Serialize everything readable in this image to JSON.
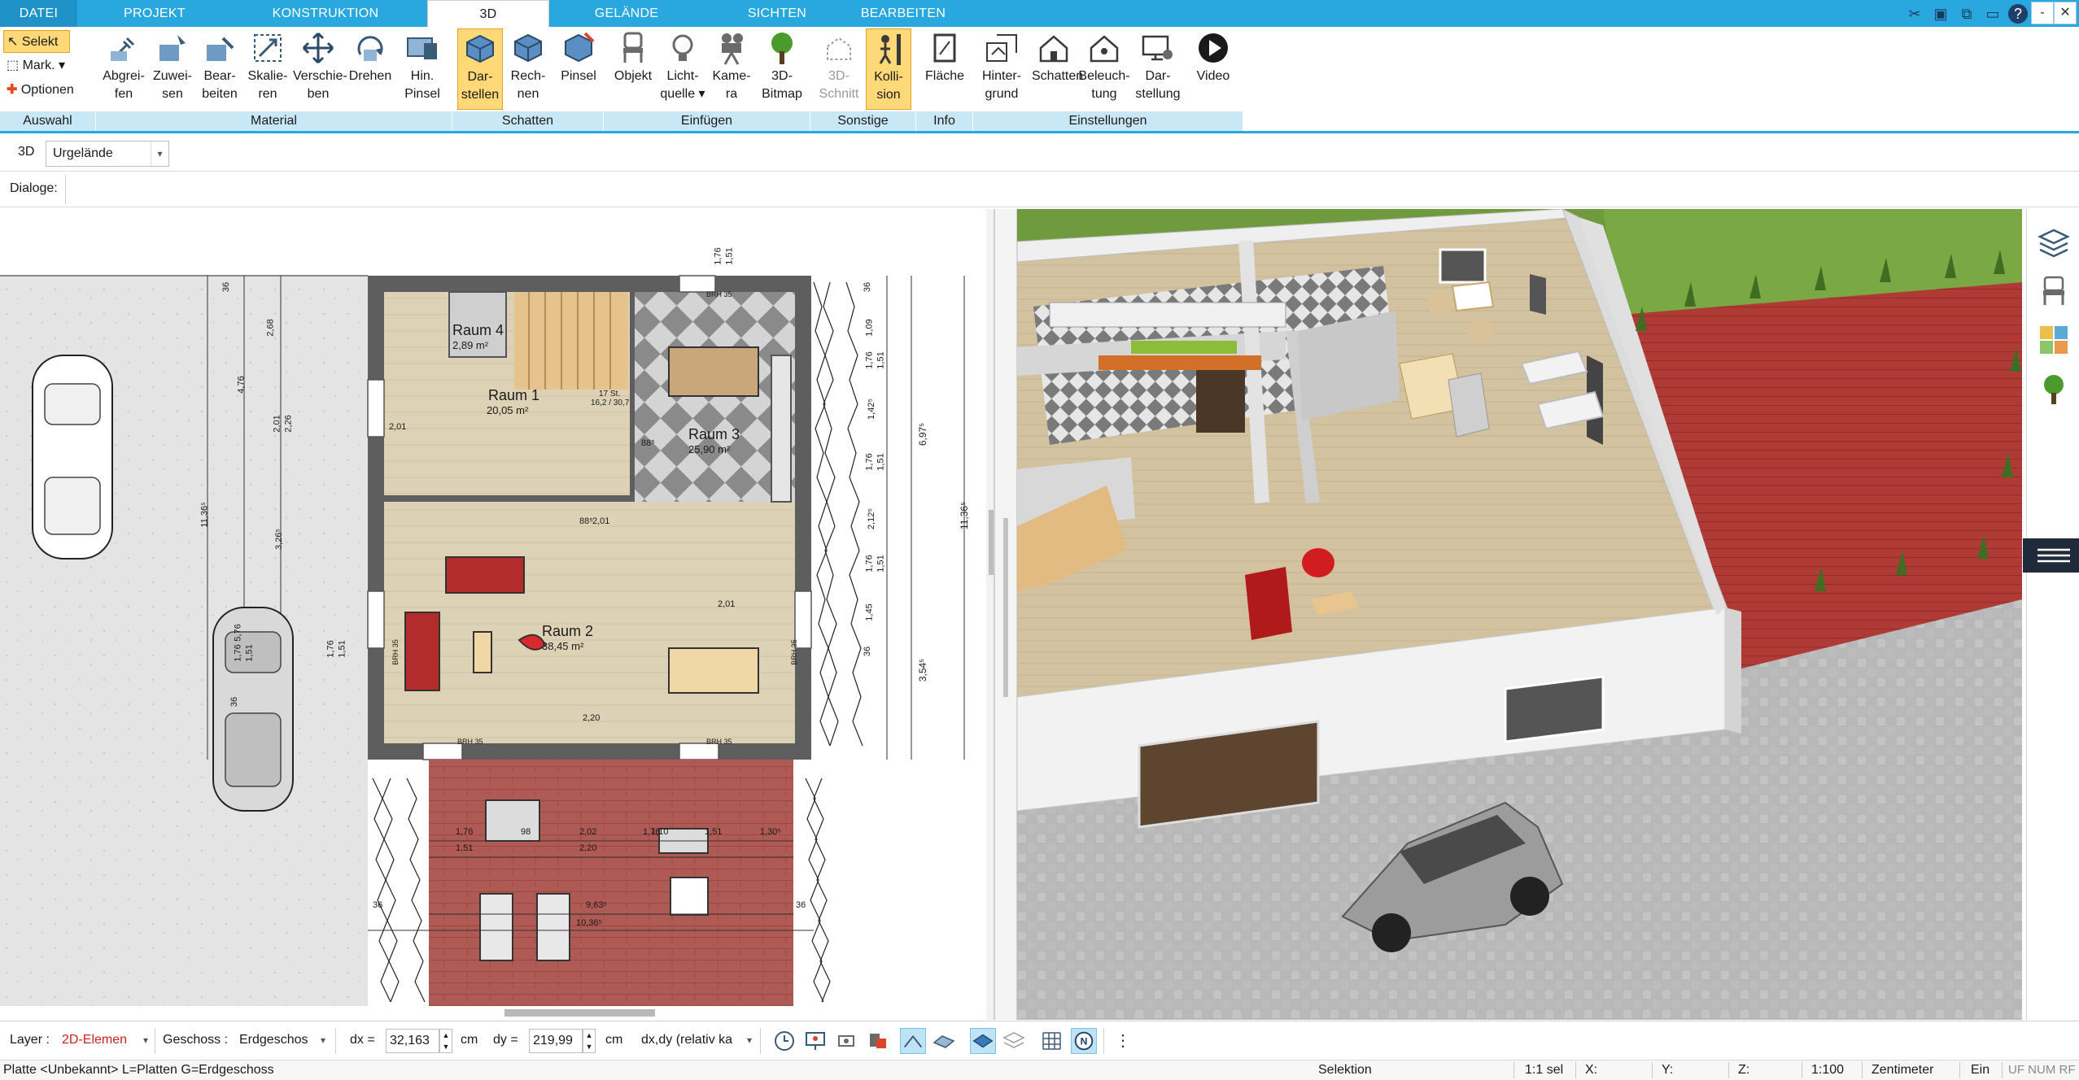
{
  "tabs": [
    {
      "label": "DATEI"
    },
    {
      "label": "PROJEKT"
    },
    {
      "label": "KONSTRUKTION"
    },
    {
      "label": "3D"
    },
    {
      "label": "GELÄNDE"
    },
    {
      "label": "SICHTEN"
    },
    {
      "label": "BEARBEITEN"
    }
  ],
  "window": {
    "minimize": "-",
    "restore": "▫",
    "close": "✕",
    "help": "?"
  },
  "ribbon": {
    "auswahl": {
      "label": "Auswahl",
      "select": "Selekt",
      "mark": "Mark.",
      "options": "Optionen"
    },
    "material": {
      "label": "Material",
      "buttons": [
        {
          "line1": "Abgrei-",
          "line2": "fen",
          "icon": "eyedropper-icon"
        },
        {
          "line1": "Zuwei-",
          "line2": "sen",
          "icon": "assign-material-icon"
        },
        {
          "line1": "Bear-",
          "line2": "beiten",
          "icon": "edit-material-icon"
        },
        {
          "line1": "Skalie-",
          "line2": "ren",
          "icon": "scale-icon"
        },
        {
          "line1": "Verschie-",
          "line2": "ben",
          "icon": "move-icon"
        },
        {
          "line1": "Drehen",
          "line2": "",
          "icon": "rotate-icon"
        },
        {
          "line1": "Hin.",
          "line2": "Pinsel",
          "icon": "brush-icon"
        }
      ]
    },
    "schatten": {
      "label": "Schatten",
      "buttons": [
        {
          "line1": "Dar-",
          "line2": "stellen",
          "icon": "cube-shadow-icon"
        },
        {
          "line1": "Rech-",
          "line2": "nen",
          "icon": "cube-calc-icon"
        },
        {
          "line1": "Pinsel",
          "line2": "",
          "icon": "cube-brush-icon"
        }
      ]
    },
    "einfuegen": {
      "label": "Einfügen",
      "buttons": [
        {
          "line1": "Objekt",
          "line2": "",
          "icon": "chair-icon"
        },
        {
          "line1": "Licht-",
          "line2": "quelle ▾",
          "icon": "bulb-icon"
        },
        {
          "line1": "Kame-",
          "line2": "ra",
          "icon": "camera-icon"
        },
        {
          "line1": "3D-",
          "line2": "Bitmap",
          "icon": "tree-icon"
        }
      ]
    },
    "sonstige": {
      "label": "Sonstige",
      "buttons": [
        {
          "line1": "3D-",
          "line2": "Schnitt",
          "icon": "section-icon"
        },
        {
          "line1": "Kolli-",
          "line2": "sion",
          "icon": "collision-icon"
        }
      ]
    },
    "info": {
      "label": "Info",
      "buttons": [
        {
          "line1": "Fläche",
          "line2": "",
          "icon": "area-icon"
        }
      ]
    },
    "einstellungen": {
      "label": "Einstellungen",
      "buttons": [
        {
          "line1": "Hinter-",
          "line2": "grund",
          "icon": "background-icon"
        },
        {
          "line1": "Schatten",
          "line2": "",
          "icon": "house-shadow-icon"
        },
        {
          "line1": "Beleuch-",
          "line2": "tung",
          "icon": "house-light-icon"
        },
        {
          "line1": "Dar-",
          "line2": "stellung",
          "icon": "display-icon"
        },
        {
          "line1": "Video",
          "line2": "",
          "icon": "play-icon"
        }
      ]
    }
  },
  "toolbar2": {
    "mode": "3D",
    "terrain": "Urgelände"
  },
  "toolbar3": {
    "dialogs": "Dialoge:"
  },
  "plan": {
    "rooms": [
      {
        "name": "Raum 4",
        "area": "2,89 m²"
      },
      {
        "name": "Raum 1",
        "area": "20,05 m²"
      },
      {
        "name": "Raum 3",
        "area": "25,90 m²"
      },
      {
        "name": "Raum 2",
        "area": "38,45 m²"
      }
    ],
    "dims_top": [
      "1,76",
      "1,51"
    ],
    "dims_right_outer": [
      "36",
      "1,09",
      "1,76",
      "1,51",
      "1,42⁵",
      "1,76",
      "1,51",
      "2,12⁵",
      "1,76",
      "1,51",
      "1,45",
      "36"
    ],
    "dims_right_total": [
      "6,97⁵",
      "3,54⁵",
      "11,36⁵"
    ],
    "dims_left": [
      "36",
      "2,68",
      "4,76",
      "2,01",
      "2,26",
      "3,26⁵",
      "11,36⁵",
      "1,76",
      "1,51",
      "5,76",
      "1,76",
      "1,51",
      "36"
    ],
    "dims_terrace": [
      "1,76",
      "1,51",
      "2,02",
      "2,20",
      "1,76",
      "1,51",
      "1,30⁵",
      "9,63⁵",
      "10,36⁵",
      "36",
      "36",
      "98",
      "1,10"
    ],
    "brh": [
      "BRH 35",
      "BRH 35",
      "BRH 35",
      "BRH 35",
      "BRH 35"
    ],
    "stair": [
      "17 St.",
      "16,2 / 30,7"
    ],
    "doors": [
      "2,01",
      "88⁵",
      "2,01",
      "88⁵",
      "2,01",
      "88⁵",
      "2,01",
      "88⁵",
      "2,20"
    ]
  },
  "bottombar": {
    "layer_label": "Layer :",
    "layer_value": "2D-Elemen",
    "floor_label": "Geschoss :",
    "floor_value": "Erdgeschos",
    "dx_label": "dx =",
    "dx_value": "32,163",
    "dx_unit": "cm",
    "dy_label": "dy =",
    "dy_value": "219,99",
    "dy_unit": "cm",
    "mode_value": "dx,dy (relativ ka"
  },
  "status": {
    "left": "Platte <Unbekannt> L=Platten G=Erdgeschoss",
    "mode": "Selektion",
    "sel": "1:1 sel",
    "x": "X:",
    "y": "Y:",
    "z": "Z:",
    "scale": "1:100",
    "unit": "Zentimeter",
    "ein": "Ein",
    "flags": "UF NUM RF"
  },
  "colors": {
    "tab_blue": "#29a8e0",
    "group_label": "#c9e8f6",
    "active_btn": "#ffd878",
    "terrace_red": "#a24a45",
    "grass": "#6f9a3e"
  }
}
